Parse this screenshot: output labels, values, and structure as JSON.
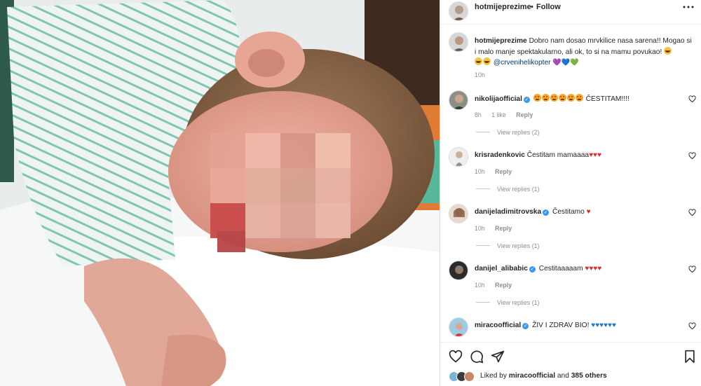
{
  "post": {
    "username": "hotmijeprezime",
    "dot": "•",
    "follow_label": "Follow",
    "caption": {
      "username": "hotmijeprezime",
      "text_line1": "Dobro nam dosao mrvkilice nasa sarena!! Mogao",
      "text_line2": "si i malo manje spektakularno, ali ok, to si na mamu povukao!",
      "mention": "@crvenihelikopter",
      "hearts": "💜💙💚",
      "time": "10h"
    }
  },
  "comments": [
    {
      "username": "nikolijaofficial",
      "verified": true,
      "text": "ČESTITAM!!!!",
      "time": "8h",
      "likes": "1 like",
      "reply_label": "Reply",
      "view_replies": "View replies (2)"
    },
    {
      "username": "krisradenkovic",
      "verified": false,
      "text": "Čestitam mamaaaa",
      "hearts": "♥♥♥",
      "time": "10h",
      "reply_label": "Reply",
      "view_replies": "View replies (1)"
    },
    {
      "username": "danijeladimitrovska",
      "verified": true,
      "text": "Čestitamo",
      "hearts": "♥",
      "time": "10h",
      "reply_label": "Reply",
      "view_replies": "View replies (1)"
    },
    {
      "username": "danijel_alibabic",
      "verified": true,
      "text": "Cestitaaaaam",
      "hearts": "♥♥♥♥",
      "time": "10h",
      "reply_label": "Reply",
      "view_replies": "View replies (1)"
    },
    {
      "username": "miracoofficial",
      "verified": true,
      "text": "ŽIV I ZDRAV BIO!",
      "hearts": "♥♥♥♥♥♥"
    }
  ],
  "likes": {
    "prefix": "Liked by",
    "user": "miracoofficial",
    "and": "and",
    "others": "385 others"
  },
  "colors": {
    "verified": "#3897f0",
    "muted": "#8e8e8e",
    "mention": "#00376b"
  },
  "icons": [
    "more-icon",
    "heart-icon",
    "comment-icon",
    "share-icon",
    "bookmark-icon",
    "verified-badge-icon"
  ]
}
